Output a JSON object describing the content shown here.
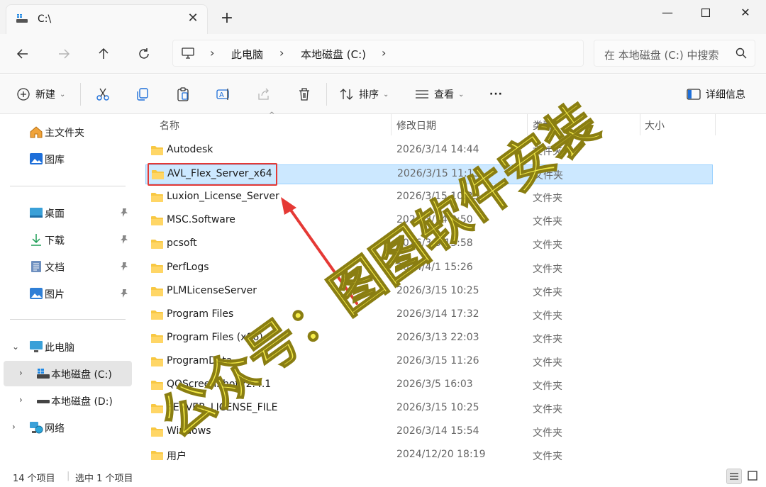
{
  "window": {
    "tab_title": "C:\\",
    "new_tab": "+",
    "minimize": "—",
    "close": "✕"
  },
  "address": {
    "crumbs": [
      "此电脑",
      "本地磁盘 (C:)"
    ],
    "search_placeholder": "在 本地磁盘 (C:) 中搜索"
  },
  "toolbar": {
    "new_label": "新建",
    "sort_label": "排序",
    "view_label": "查看",
    "more_label": "···",
    "details_label": "详细信息"
  },
  "sidebar": {
    "home": "主文件夹",
    "gallery": "图库",
    "desktop": "桌面",
    "downloads": "下载",
    "documents": "文档",
    "pictures": "图片",
    "this_pc": "此电脑",
    "drive_c": "本地磁盘 (C:)",
    "drive_d": "本地磁盘 (D:)",
    "network": "网络"
  },
  "columns": {
    "name": "名称",
    "modified": "修改日期",
    "type": "类型",
    "size": "大小"
  },
  "files": [
    {
      "name": "Autodesk",
      "date": "2026/3/14 14:44",
      "type": "文件夹"
    },
    {
      "name": "AVL_Flex_Server_x64",
      "date": "2026/3/15 11:13",
      "type": "文件夹"
    },
    {
      "name": "Luxion_License_Server",
      "date": "2026/3/15 10:25",
      "type": "文件夹"
    },
    {
      "name": "MSC.Software",
      "date": "2026/3/14 9:50",
      "type": "文件夹"
    },
    {
      "name": "pcsoft",
      "date": "2026/3/5 15:58",
      "type": "文件夹"
    },
    {
      "name": "PerfLogs",
      "date": "2024/4/1 15:26",
      "type": "文件夹"
    },
    {
      "name": "PLMLicenseServer",
      "date": "2026/3/15 10:25",
      "type": "文件夹"
    },
    {
      "name": "Program Files",
      "date": "2026/3/14 17:32",
      "type": "文件夹"
    },
    {
      "name": "Program Files (x86)",
      "date": "2026/3/13 22:03",
      "type": "文件夹"
    },
    {
      "name": "ProgramData",
      "date": "2026/3/15 11:26",
      "type": "文件夹"
    },
    {
      "name": "QQScreenShotV2.4.1",
      "date": "2026/3/5 16:03",
      "type": "文件夹"
    },
    {
      "name": "SERVER_LICENSE_FILE",
      "date": "2026/3/15 10:25",
      "type": "文件夹"
    },
    {
      "name": "Windows",
      "date": "2026/3/14 15:54",
      "type": "文件夹"
    },
    {
      "name": "用户",
      "date": "2024/12/20 18:19",
      "type": "文件夹"
    }
  ],
  "status": {
    "item_count": "14 个项目",
    "selected": "选中 1 个项目"
  },
  "watermark": "公众号：图图软件安装",
  "colors": {
    "selection_bg": "#cce8ff",
    "selection_border": "#99d1ff",
    "highlight_box": "#e53935",
    "watermark_fill": "#f4ea2a",
    "folder_yellow": "#f8c843"
  }
}
